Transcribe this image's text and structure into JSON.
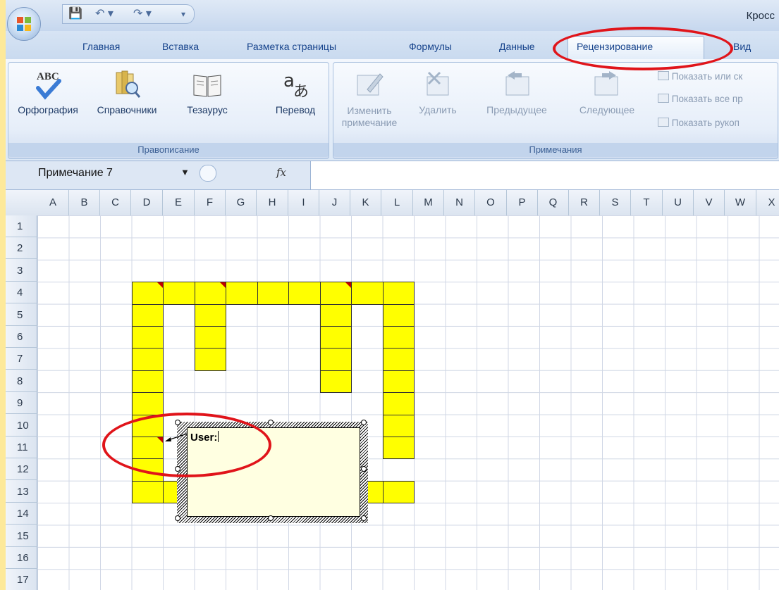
{
  "app": {
    "title": "Кросс"
  },
  "qat": {
    "save": "💾",
    "undo": "↶ ▾",
    "redo": "↷ ▾",
    "customize": "▾"
  },
  "tabs": [
    "Главная",
    "Вставка",
    "Разметка страницы",
    "Формулы",
    "Данные",
    "Рецензирование",
    "Вид"
  ],
  "ribbon": {
    "proofing": {
      "label": "Правописание",
      "buttons": [
        "Орфография",
        "Справочники",
        "Тезаурус",
        "Перевод"
      ],
      "abc": "ABC"
    },
    "comments": {
      "label": "Примечания",
      "edit": [
        "Изменить",
        "примечание"
      ],
      "delete": "Удалить",
      "previous": "Предыдущее",
      "next": "Следующее",
      "show_hide": "Показать или ск",
      "show_all": "Показать все пр",
      "show_ink": "Показать рукоп"
    }
  },
  "formula_bar": {
    "name_box": "Примечание 7",
    "fx": "fx"
  },
  "columns": [
    "A",
    "B",
    "C",
    "D",
    "E",
    "F",
    "G",
    "H",
    "I",
    "J",
    "K",
    "L",
    "M",
    "N",
    "O",
    "P",
    "Q",
    "R",
    "S",
    "T",
    "U",
    "V",
    "W",
    "X"
  ],
  "rows": [
    "1",
    "2",
    "3",
    "4",
    "5",
    "6",
    "7",
    "8",
    "9",
    "10",
    "11",
    "12",
    "13",
    "14",
    "15",
    "16",
    "17"
  ],
  "comment": {
    "author": "User:"
  },
  "colors": {
    "highlight_cell": "#ffff00",
    "comment_marker": "#c00000",
    "annotation": "#e0141a",
    "tab_text": "#15428b"
  }
}
